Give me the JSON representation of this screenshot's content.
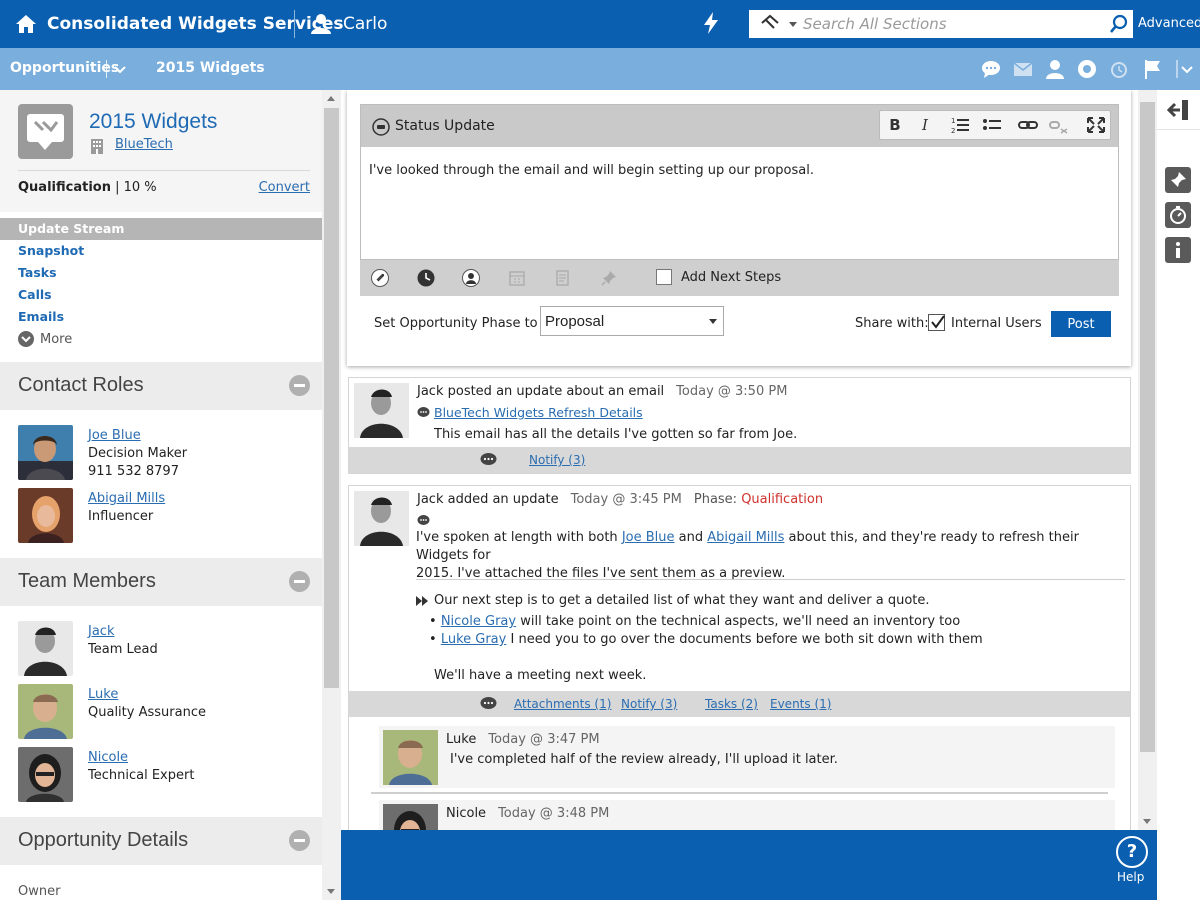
{
  "topbar": {
    "app_title": "Consolidated Widgets Services",
    "user_name": "Carlo",
    "search_placeholder": "Search All Sections",
    "advanced_label": "Advanced"
  },
  "subbar": {
    "module_label": "Opportunities",
    "breadcrumb": "2015 Widgets",
    "icons": [
      "chat-icon",
      "mail-icon",
      "contact-icon",
      "support-icon",
      "alarm-icon",
      "flag-icon",
      "chevron-down-icon"
    ]
  },
  "opportunity": {
    "title": "2015 Widgets",
    "company": "BlueTech",
    "phase": "Qualification",
    "probability": "| 10 %",
    "convert_label": "Convert"
  },
  "nav": {
    "items": [
      {
        "label": "Update Stream",
        "active": true
      },
      {
        "label": "Snapshot"
      },
      {
        "label": "Tasks"
      },
      {
        "label": "Calls"
      },
      {
        "label": "Emails"
      }
    ],
    "more_label": "More"
  },
  "sections": {
    "contact_roles": {
      "title": "Contact Roles",
      "people": [
        {
          "name": "Joe Blue",
          "role": "Decision Maker",
          "phone": "911 532 8797"
        },
        {
          "name": "Abigail Mills",
          "role": "Influencer"
        }
      ]
    },
    "team_members": {
      "title": "Team Members",
      "people": [
        {
          "name": "Jack",
          "role": "Team Lead"
        },
        {
          "name": "Luke",
          "role": "Quality Assurance"
        },
        {
          "name": "Nicole",
          "role": "Technical Expert"
        }
      ]
    },
    "opportunity_details": {
      "title": "Opportunity Details",
      "owner_label": "Owner"
    }
  },
  "composer": {
    "title": "Status Update",
    "text": "I've looked through the email and will begin setting up our proposal.",
    "add_next_steps_label": "Add Next Steps",
    "set_phase_label": "Set Opportunity Phase to",
    "phase_value": "Proposal",
    "share_with_label": "Share with:",
    "share_users_label": "Internal Users",
    "post_label": "Post"
  },
  "feed": [
    {
      "author_line": "Jack posted an update about an email",
      "time": "Today @ 3:50 PM",
      "link": "BlueTech Widgets Refresh Details",
      "body": "This email has all the details I've gotten so far from Joe.",
      "notify": "Notify (3)"
    },
    {
      "author_line": "Jack added an update",
      "time": "Today @ 3:45 PM",
      "phase_key": "Phase:",
      "phase_value": "Qualification",
      "body_pre": "I've spoken at length with both",
      "mention1": "Joe Blue",
      "body_and": "and",
      "mention2": "Abigail Mills",
      "body_post": "about this, and they're ready to refresh their Widgets for",
      "body_line2": "2015. I've attached the files I've sent them as a preview.",
      "next_step": "Our next step is to get a detailed list of what they want and deliver a quote.",
      "bullets": [
        {
          "mention": "Nicole Gray",
          "text": "will take point on the technical aspects, we'll need an inventory too"
        },
        {
          "mention": "Luke Gray",
          "text": "I need you to go over the documents before we both sit down with them"
        }
      ],
      "closing": "We'll have a meeting next week.",
      "links": {
        "attachments": "Attachments (1)",
        "notify": "Notify (3)",
        "tasks": "Tasks (2)",
        "events": "Events (1)"
      },
      "replies": [
        {
          "name": "Luke",
          "time": "Today @ 3:47 PM",
          "text": "I've completed half of the review already, I'll upload it later."
        },
        {
          "name": "Nicole",
          "time": "Today @ 3:48 PM"
        }
      ]
    }
  ],
  "help_label": "Help",
  "colors": {
    "primary": "#0a5fb0",
    "secondary_bar": "#7aaedd",
    "link": "#2a6db0",
    "phase_red": "#d0312d"
  }
}
